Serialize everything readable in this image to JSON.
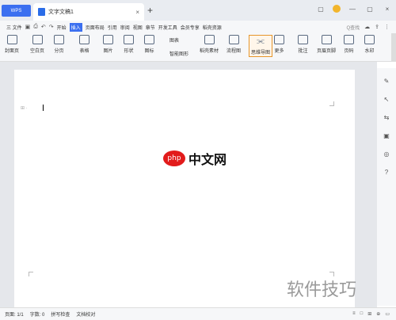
{
  "titlebar": {
    "brand": "WPS",
    "doc_tab": "文字文稿1",
    "close": "×",
    "plus": "+"
  },
  "window": {
    "buttons": [
      "▢",
      "—",
      "▢",
      "×"
    ]
  },
  "menubar": {
    "file": "三 文件",
    "items": [
      "开始",
      "插入",
      "页面布局",
      "引用",
      "审阅",
      "视图",
      "章节",
      "开发工具",
      "会员专享",
      "稻壳资源"
    ],
    "active": "插入",
    "search": "Q查找"
  },
  "ribbon": {
    "items": [
      "封面页",
      "空白页",
      "分页",
      "表格",
      "图片",
      "形状",
      "图标",
      "稻壳素材",
      "流程图",
      "思维导图",
      "更多",
      "批注",
      "页眉页脚",
      "页码",
      "水印"
    ],
    "small_items": [
      "图表",
      "智能图形"
    ],
    "highlight": "思维导图"
  },
  "watermark": {
    "logo": "php",
    "text": "中文网",
    "bottom": "软件技巧"
  },
  "statusbar": {
    "page": "页面: 1/1",
    "words": "字数: 0",
    "spell": "拼写检查",
    "proof": "文档校对",
    "zoom_icons": [
      "≡",
      "□",
      "⊞",
      "⊕",
      "▭"
    ]
  },
  "rightbar": {
    "icons": [
      "✎",
      "↖",
      "⇆",
      "▣",
      "◎",
      "?"
    ]
  }
}
